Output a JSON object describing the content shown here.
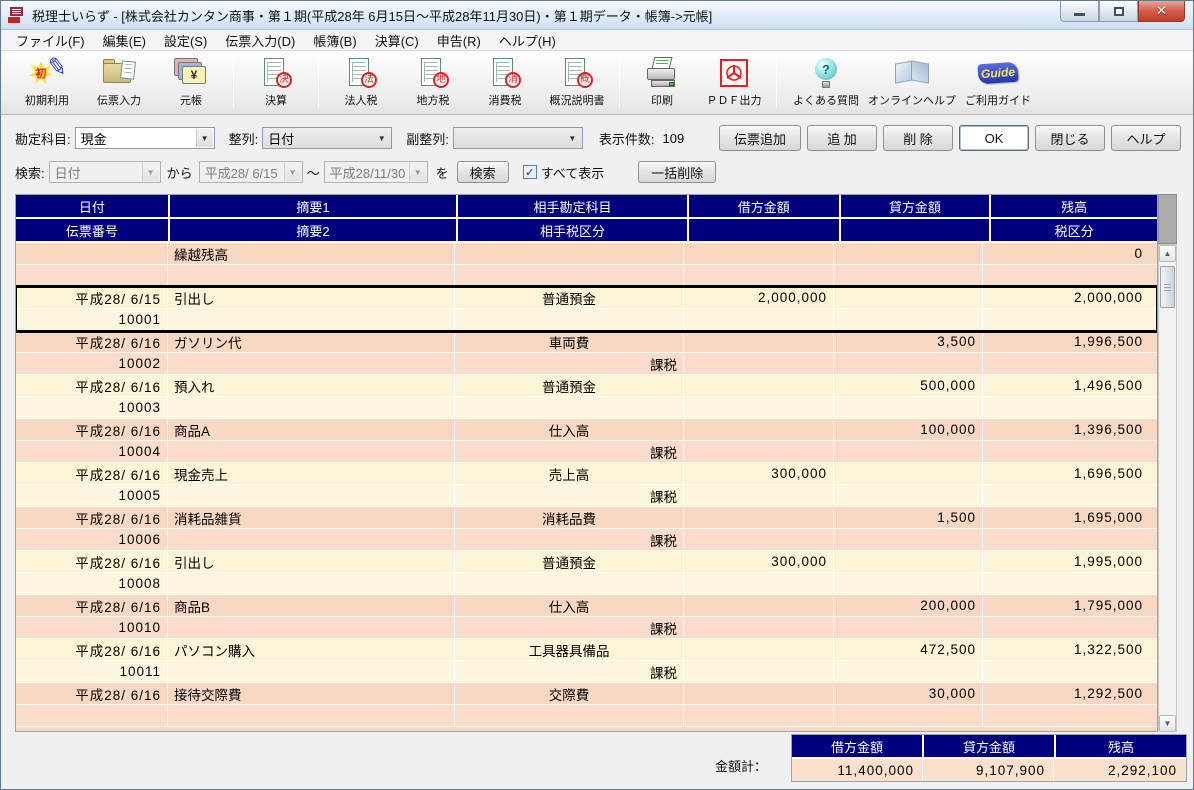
{
  "window": {
    "title": "税理士いらず - [株式会社カンタン商事・第１期(平成28年 6月15日～平成28年11月30日)・第１期データ・帳簿->元帳]"
  },
  "menu": {
    "items": [
      "ファイル(F)",
      "編集(E)",
      "設定(S)",
      "伝票入力(D)",
      "帳簿(B)",
      "決算(C)",
      "申告(R)",
      "ヘルプ(H)"
    ]
  },
  "toolbar": {
    "buttons": [
      {
        "name": "initial-setup",
        "label": "初期利用",
        "icon": "init",
        "badge": "初"
      },
      {
        "name": "voucher-entry",
        "label": "伝票入力",
        "icon": "folder",
        "badge": ""
      },
      {
        "name": "ledger",
        "label": "元帳",
        "icon": "cards",
        "badge": "¥"
      },
      {
        "name": "settlement",
        "label": "決算",
        "icon": "doc",
        "badge": "決",
        "sep_before": true
      },
      {
        "name": "corporate-tax",
        "label": "法人税",
        "icon": "doc",
        "badge": "法",
        "sep_before": true
      },
      {
        "name": "local-tax",
        "label": "地方税",
        "icon": "doc",
        "badge": "地"
      },
      {
        "name": "consumption-tax",
        "label": "消費税",
        "icon": "doc",
        "badge": "消"
      },
      {
        "name": "overview-statement",
        "label": "概況説明書",
        "icon": "doc",
        "badge": "概"
      },
      {
        "name": "print",
        "label": "印刷",
        "icon": "printer",
        "badge": "",
        "sep_before": true
      },
      {
        "name": "pdf-export",
        "label": "ＰＤＦ出力",
        "icon": "pdf",
        "badge": ""
      },
      {
        "name": "faq",
        "label": "よくある質問",
        "icon": "bulb",
        "badge": "?",
        "sep_before": true
      },
      {
        "name": "online-help",
        "label": "オンラインヘルプ",
        "icon": "book",
        "badge": ""
      },
      {
        "name": "user-guide",
        "label": "ご利用ガイド",
        "icon": "guide",
        "badge": "Guide"
      }
    ]
  },
  "filters": {
    "account_label": "勘定科目:",
    "account_value": "現金",
    "sort_label": "整列:",
    "sort_value": "日付",
    "subsort_label": "副整列:",
    "subsort_value": "",
    "count_label": "表示件数:",
    "count_value": "109",
    "buttons": [
      {
        "name": "add-voucher",
        "label": "伝票追加"
      },
      {
        "name": "add-row",
        "label": "追 加"
      },
      {
        "name": "delete-row",
        "label": "削 除"
      },
      {
        "name": "ok",
        "label": "OK",
        "default": true
      },
      {
        "name": "close",
        "label": "閉じる"
      },
      {
        "name": "help",
        "label": "ヘルプ"
      }
    ],
    "search_label": "検索:",
    "search_field_value": "日付",
    "from_label": "から",
    "date_from": "平成28/ 6/15",
    "range_tilde": "～",
    "date_to": "平成28/11/30",
    "wo_label": "を",
    "search_button_label": "検索",
    "show_all_checked": true,
    "show_all_label": "すべて表示",
    "bulk_delete_label": "一括削除"
  },
  "table": {
    "header_row1": [
      "日付",
      "摘要1",
      "相手勘定科目",
      "借方金額",
      "貸方金額",
      "残高"
    ],
    "header_row2": [
      "伝票番号",
      "摘要2",
      "相手税区分",
      "",
      "",
      "税区分"
    ],
    "rows": [
      {
        "date": "",
        "memo1": "繰越残高",
        "account": "",
        "debit": "",
        "credit": "",
        "balance": "0",
        "voucher": "",
        "memo2": "",
        "tax": "",
        "tax_dist": "",
        "color": "pink",
        "selected": false
      },
      {
        "date": "平成28/ 6/15",
        "memo1": "引出し",
        "account": "普通預金",
        "debit": "2,000,000",
        "credit": "",
        "balance": "2,000,000",
        "voucher": "10001",
        "memo2": "",
        "tax": "",
        "tax_dist": "",
        "color": "cream",
        "selected": true
      },
      {
        "date": "平成28/ 6/16",
        "memo1": "ガソリン代",
        "account": "車両費",
        "debit": "",
        "credit": "3,500",
        "balance": "1,996,500",
        "voucher": "10002",
        "memo2": "",
        "tax": "課税",
        "tax_dist": "",
        "color": "pink",
        "selected": false
      },
      {
        "date": "平成28/ 6/16",
        "memo1": "預入れ",
        "account": "普通預金",
        "debit": "",
        "credit": "500,000",
        "balance": "1,496,500",
        "voucher": "10003",
        "memo2": "",
        "tax": "",
        "tax_dist": "",
        "color": "cream",
        "selected": false
      },
      {
        "date": "平成28/ 6/16",
        "memo1": "商品A",
        "account": "仕入高",
        "debit": "",
        "credit": "100,000",
        "balance": "1,396,500",
        "voucher": "10004",
        "memo2": "",
        "tax": "課税",
        "tax_dist": "",
        "color": "pink",
        "selected": false
      },
      {
        "date": "平成28/ 6/16",
        "memo1": "現金売上",
        "account": "売上高",
        "debit": "300,000",
        "credit": "",
        "balance": "1,696,500",
        "voucher": "10005",
        "memo2": "",
        "tax": "課税",
        "tax_dist": "",
        "color": "cream",
        "selected": false
      },
      {
        "date": "平成28/ 6/16",
        "memo1": "消耗品雑貨",
        "account": "消耗品費",
        "debit": "",
        "credit": "1,500",
        "balance": "1,695,000",
        "voucher": "10006",
        "memo2": "",
        "tax": "課税",
        "tax_dist": "",
        "color": "pink",
        "selected": false
      },
      {
        "date": "平成28/ 6/16",
        "memo1": "引出し",
        "account": "普通預金",
        "debit": "300,000",
        "credit": "",
        "balance": "1,995,000",
        "voucher": "10008",
        "memo2": "",
        "tax": "",
        "tax_dist": "",
        "color": "cream",
        "selected": false
      },
      {
        "date": "平成28/ 6/16",
        "memo1": "商品B",
        "account": "仕入高",
        "debit": "",
        "credit": "200,000",
        "balance": "1,795,000",
        "voucher": "10010",
        "memo2": "",
        "tax": "課税",
        "tax_dist": "",
        "color": "pink",
        "selected": false
      },
      {
        "date": "平成28/ 6/16",
        "memo1": "パソコン購入",
        "account": "工具器具備品",
        "debit": "",
        "credit": "472,500",
        "balance": "1,322,500",
        "voucher": "10011",
        "memo2": "",
        "tax": "課税",
        "tax_dist": "",
        "color": "cream",
        "selected": false
      },
      {
        "date": "平成28/ 6/16",
        "memo1": "接待交際費",
        "account": "交際費",
        "debit": "",
        "credit": "30,000",
        "balance": "1,292,500",
        "voucher": "",
        "memo2": "",
        "tax": "",
        "tax_dist": "",
        "color": "pink",
        "selected": false
      }
    ]
  },
  "totals": {
    "label": "金額計：",
    "headers": [
      "借方金額",
      "貸方金額",
      "残高"
    ],
    "values": [
      "11,400,000",
      "9,107,900",
      "2,292,100"
    ]
  },
  "colors": {
    "header_navy": "#00007E",
    "row_pink": "#F8D8C2",
    "row_cream": "#FCF4D6",
    "close_red": "#C23A28"
  }
}
